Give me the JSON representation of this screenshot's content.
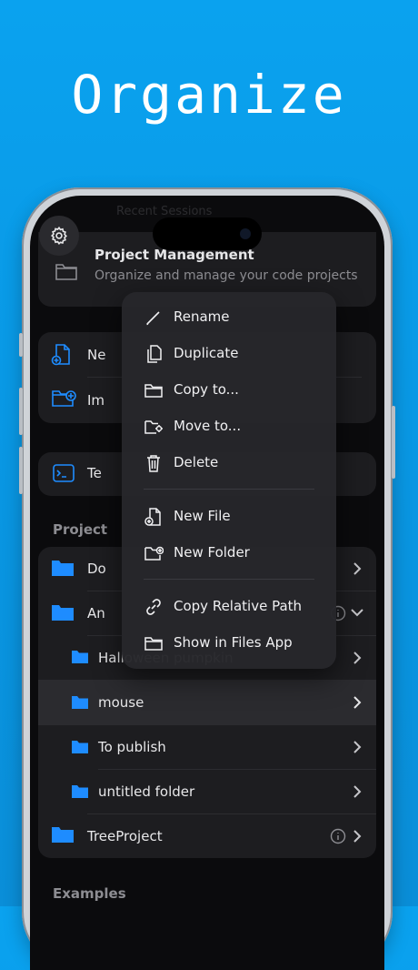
{
  "headline": "Organize",
  "header": {
    "faint_title": "Recent Sessions",
    "title": "Project Management",
    "subtitle": "Organize and manage your code projects"
  },
  "actions": {
    "new_file_partial": "Ne",
    "import_partial": "Im",
    "terminal_partial": "Te"
  },
  "sections": {
    "projects": "Project",
    "examples": "Examples"
  },
  "tree": [
    {
      "label": "Do",
      "level": 0
    },
    {
      "label": "An",
      "level": 0,
      "expanded": true
    },
    {
      "label": "Halloween pumpkin",
      "level": 1
    },
    {
      "label": "mouse",
      "level": 1,
      "selected": true
    },
    {
      "label": "To publish",
      "level": 1
    },
    {
      "label": "untitled folder",
      "level": 1
    },
    {
      "label": "TreeProject",
      "level": 0
    }
  ],
  "context_menu": {
    "rename": "Rename",
    "duplicate": "Duplicate",
    "copy_to": "Copy to...",
    "move_to": "Move to...",
    "delete": "Delete",
    "new_file": "New File",
    "new_folder": "New Folder",
    "copy_relative_path": "Copy Relative Path",
    "show_in_files": "Show in Files App"
  },
  "colors": {
    "background": "#0aa2ef",
    "accent": "#1e8cff",
    "screen": "#0b0b0d",
    "card": "#1d1d20"
  }
}
